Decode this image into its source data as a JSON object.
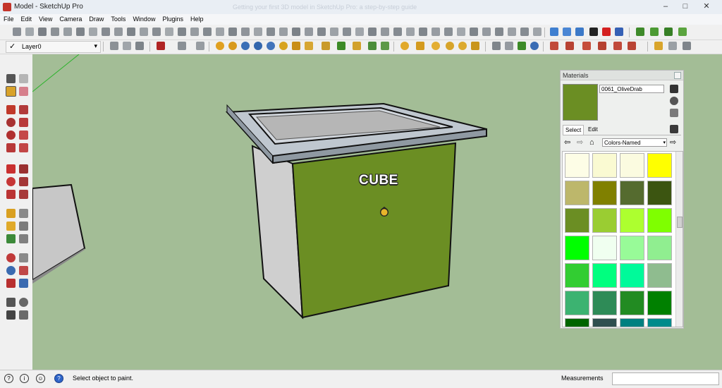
{
  "window": {
    "title": "Model - SketchUp Pro",
    "faded_caption": "Getting your first 3D model in SketchUp Pro: a step-by-step guide"
  },
  "menu": [
    "File",
    "Edit",
    "View",
    "Camera",
    "Draw",
    "Tools",
    "Window",
    "Plugins",
    "Help"
  ],
  "layer_toolbar": {
    "current_layer": "Layer0"
  },
  "model": {
    "text_label": "CUBE"
  },
  "materials": {
    "title": "Materials",
    "current_material": "0061_OliveDrab",
    "current_color": "#6b8e23",
    "tabs": [
      "Select",
      "Edit"
    ],
    "collection": "Colors-Named",
    "swatches": [
      "#fdfde6",
      "#fafad2",
      "#fbfbe0",
      "#ffff00",
      "#bdb76b",
      "#808000",
      "#556b2f",
      "#3c5511",
      "#6b8e23",
      "#9acd32",
      "#adff2f",
      "#7fff00",
      "#00ff00",
      "#f0fff0",
      "#98fb98",
      "#90ee90",
      "#32cd32",
      "#00ff7f",
      "#00fa9a",
      "#8fbc8f",
      "#3cb371",
      "#2e8b57",
      "#228b22",
      "#008000",
      "#006400",
      "#2f4f4f",
      "#008080",
      "#008b8b"
    ]
  },
  "status": {
    "message": "Select object to paint.",
    "measurements_label": "Measurements"
  }
}
